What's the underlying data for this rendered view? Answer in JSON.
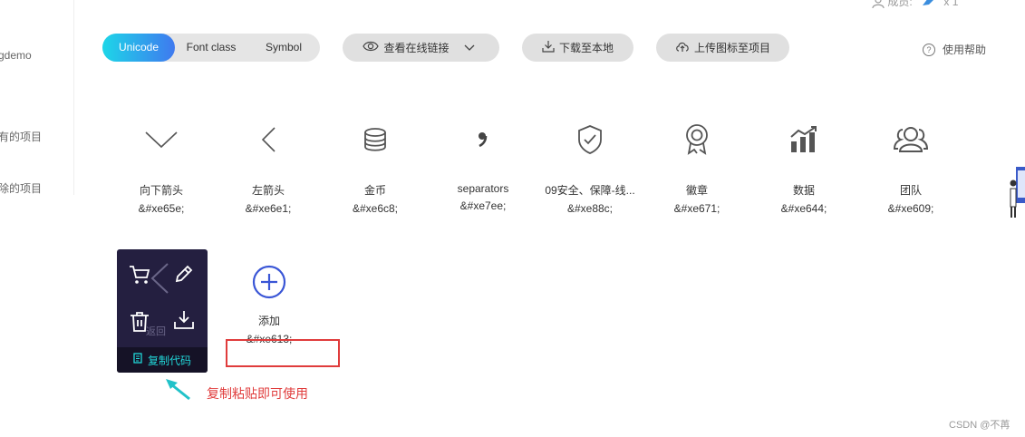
{
  "sidebar": {
    "items": [
      "gdemo",
      "有的项目",
      "除的项目"
    ]
  },
  "topbar": {
    "user_label": "成员:",
    "user_count": "x 1"
  },
  "tabs": {
    "options": [
      "Unicode",
      "Font class",
      "Symbol"
    ],
    "active": "Unicode"
  },
  "actions": {
    "view_link": "查看在线链接",
    "download": "下载至本地",
    "upload": "上传图标至项目",
    "help": "使用帮助"
  },
  "icons": [
    {
      "name": "向下箭头",
      "code": "&#xe65e;",
      "icon": "chevron-down-icon"
    },
    {
      "name": "左箭头",
      "code": "&#xe6e1;",
      "icon": "chevron-left-icon"
    },
    {
      "name": "金币",
      "code": "&#xe6c8;",
      "icon": "coins-icon"
    },
    {
      "name": "separators",
      "code": "&#xe7ee;",
      "icon": "comma-icon"
    },
    {
      "name": "09安全、保障-线...",
      "code": "&#xe88c;",
      "icon": "shield-check-icon"
    },
    {
      "name": "徽章",
      "code": "&#xe671;",
      "icon": "badge-icon"
    },
    {
      "name": "数据",
      "code": "&#xe644;",
      "icon": "bar-chart-icon"
    },
    {
      "name": "团队",
      "code": "&#xe609;",
      "icon": "team-icon"
    }
  ],
  "second_row": [
    {
      "name": "返回",
      "code": "",
      "icon": "chevron-left-icon"
    },
    {
      "name": "添加",
      "code": "&#xe613;",
      "icon": "plus-circle-icon"
    }
  ],
  "overlay": {
    "copy_label": "复制代码"
  },
  "annotation": {
    "note": "复制粘贴即可使用"
  },
  "watermark": "CSDN @不苒",
  "colors": {
    "accent_start": "#1dd6e8",
    "accent_end": "#3f79ef",
    "highlight": "#e03c3c",
    "overlay_bg": "#241f40"
  }
}
